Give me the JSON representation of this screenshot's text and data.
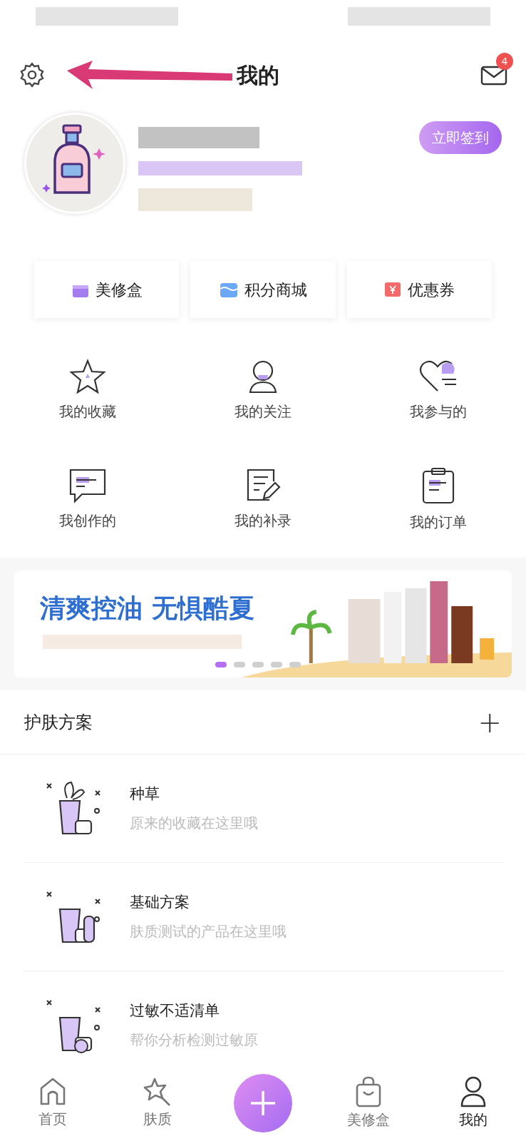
{
  "header": {
    "title": "我的",
    "badge": "4"
  },
  "profile": {
    "checkin_button": "立即签到"
  },
  "shortcuts": [
    {
      "kind": "box",
      "label": "美修盒"
    },
    {
      "kind": "mall",
      "label": "积分商城"
    },
    {
      "kind": "coupon",
      "label": "优惠券"
    }
  ],
  "features": [
    {
      "kind": "star",
      "label": "我的收藏"
    },
    {
      "kind": "person",
      "label": "我的关注"
    },
    {
      "kind": "heart",
      "label": "我参与的"
    },
    {
      "kind": "chat",
      "label": "我创作的"
    },
    {
      "kind": "edit",
      "label": "我的补录"
    },
    {
      "kind": "clipboard",
      "label": "我的订单"
    }
  ],
  "banner": {
    "headline": "清爽控油 无惧酷夏",
    "dots": [
      {
        "selected": true
      },
      {
        "selected": false
      },
      {
        "selected": false
      },
      {
        "selected": false
      },
      {
        "selected": false
      }
    ]
  },
  "skincare": {
    "title": "护肤方案",
    "add": "+",
    "items": [
      {
        "title": "种草",
        "subtitle": "原来的收藏在这里哦"
      },
      {
        "title": "基础方案",
        "subtitle": "肤质测试的产品在这里哦"
      },
      {
        "title": "过敏不适清单",
        "subtitle": "帮你分析检测过敏原"
      }
    ]
  },
  "tabbar": [
    {
      "kind": "home",
      "label": "首页",
      "selected": false
    },
    {
      "kind": "skin",
      "label": "肤质",
      "selected": false
    },
    {
      "kind": "plus",
      "selected": false
    },
    {
      "kind": "bag",
      "label": "美修盒",
      "selected": false
    },
    {
      "kind": "me",
      "label": "我的",
      "selected": true
    }
  ]
}
